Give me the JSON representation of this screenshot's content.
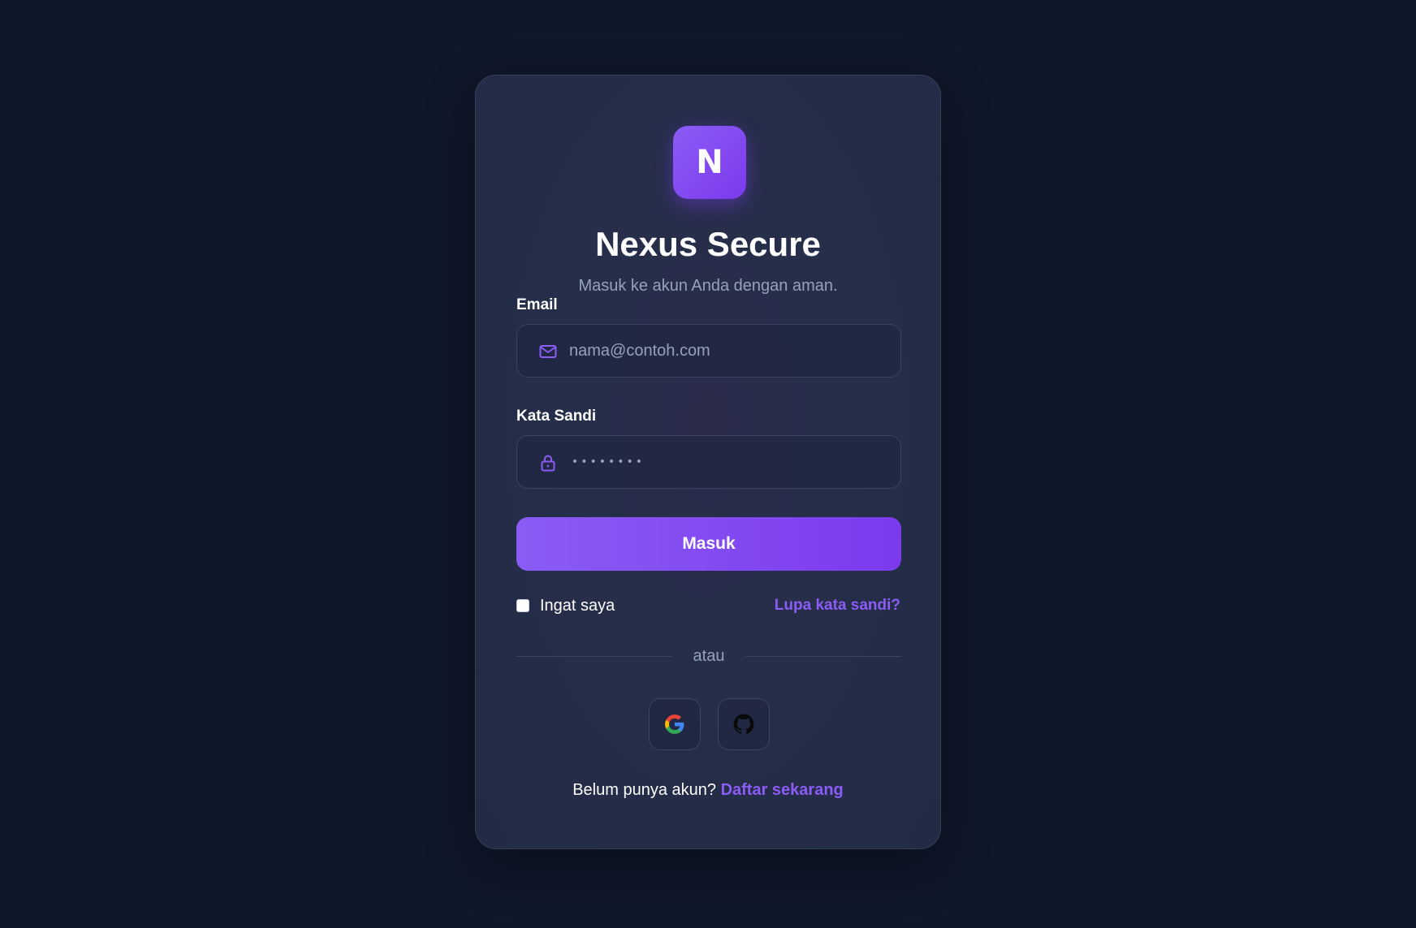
{
  "app": {
    "logo_letter": "N",
    "title": "Nexus Secure",
    "subtitle": "Masuk ke akun Anda dengan aman."
  },
  "form": {
    "email": {
      "label": "Email",
      "placeholder": "nama@contoh.com",
      "value": "",
      "icon": "mail-icon"
    },
    "password": {
      "label": "Kata Sandi",
      "masked_value": "••••••••",
      "icon": "lock-icon"
    },
    "submit_label": "Masuk",
    "remember_label": "Ingat saya",
    "remember_checked": false,
    "forgot_label": "Lupa kata sandi?"
  },
  "divider_text": "atau",
  "social": [
    {
      "name": "google",
      "icon": "google-icon"
    },
    {
      "name": "github",
      "icon": "github-icon"
    }
  ],
  "signup": {
    "prompt": "Belum punya akun?",
    "link_label": "Daftar sekarang"
  },
  "colors": {
    "background": "#0f172a",
    "card": "#262e4a",
    "accent": "#8b5cf6",
    "accent_dark": "#7c3aed",
    "muted_text": "#94a3b8"
  }
}
